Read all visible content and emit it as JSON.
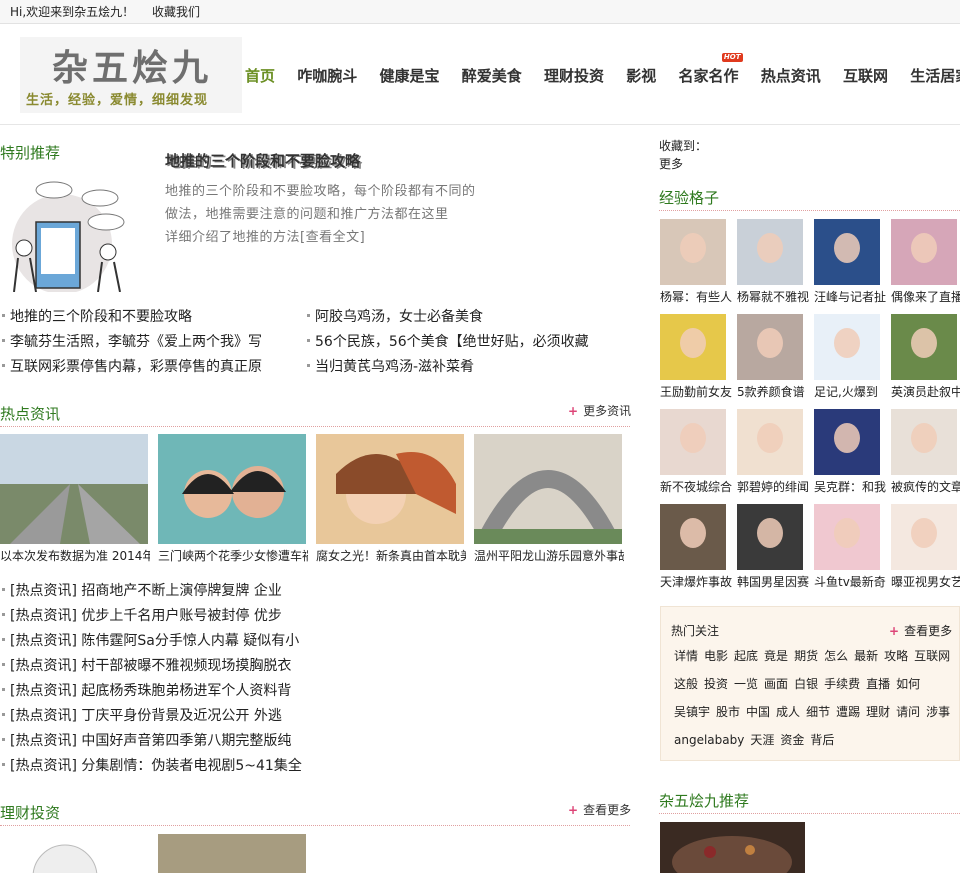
{
  "topbar": {
    "welcome": "Hi,欢迎来到杂五烩九！",
    "bookmark": "收藏我们"
  },
  "logo": {
    "title": "杂五烩九",
    "slogan": "生活，经验，爱情，细细发现"
  },
  "nav": {
    "items": [
      "首页",
      "咋咖腕斗",
      "健康是宝",
      "醉爱美食",
      "理财投资",
      "影视",
      "名家名作",
      "热点资讯",
      "互联网",
      "生活居家"
    ],
    "hot_badge": "HOT"
  },
  "featured": {
    "title": "特别推荐",
    "headline": "地推的三个阶段和不要脸攻略",
    "excerpt_lines": [
      "地推的三个阶段和不要脸攻略，每个阶段都有不同的",
      "做法，地推需要注意的问题和推广方法都在这里",
      "详细介绍了地推的方法[查看全文]"
    ],
    "links": [
      "地推的三个阶段和不要脸攻略",
      "阿胶乌鸡汤，女士必备美食",
      "李毓芬生活照，李毓芬《爱上两个我》写",
      "56个民族，56个美食【绝世好贴，必须收藏",
      "互联网彩票停售内幕，彩票停售的真正原",
      "当归黄芪乌鸡汤-滋补菜肴"
    ]
  },
  "hot_news": {
    "title": "热点资讯",
    "more": "更多资讯",
    "thumbs": [
      "以本次发布数据为准 2014年",
      "三门峡两个花季少女惨遭车祸",
      "腐女之光！新条真由首本耽美",
      "温州平阳龙山游乐园意外事故"
    ],
    "headlines": [
      "[热点资讯] 招商地产不断上演停牌复牌 企业",
      "[热点资讯] 优步上千名用户账号被封停 优步",
      "[热点资讯] 陈伟霆阿Sa分手惊人内幕 疑似有小",
      "[热点资讯] 村干部被曝不雅视频现场摸胸脱衣",
      "[热点资讯] 起底杨秀珠胞弟杨进军个人资料背",
      "[热点资讯] 丁庆平身份背景及近况公开 外逃",
      "[热点资讯] 中国好声音第四季第八期完整版纯",
      "[热点资讯] 分集剧情：伪装者电视剧5~41集全"
    ]
  },
  "finance": {
    "title": "理财投资",
    "more": "查看更多"
  },
  "sidebar": {
    "collect_label": "收藏到：",
    "more_label": "更多",
    "jingyan_title": "经验格子",
    "grid_captions": [
      "杨幂：有些人",
      "杨幂就不雅视",
      "汪峰与记者扯",
      "偶像来了直播",
      "王励勤前女友",
      "5款养颜食谱",
      "足记,火爆到",
      "英演员赴叙中",
      "新不夜城综合",
      "郭碧婷的绯闻",
      "吴克群：和我",
      "被疯传的文章",
      "天津爆炸事故",
      "韩国男星因赛",
      "斗鱼tv最新奇",
      "曝亚视男女艺"
    ],
    "tags_title": "热门关注",
    "tags_more": "查看更多",
    "tag_rows": [
      [
        "详情",
        "电影",
        "起底",
        "竟是",
        "期货",
        "怎么",
        "最新",
        "攻略",
        "互联网"
      ],
      [
        "这般",
        "投资",
        "一览",
        "画面",
        "白银",
        "手续费",
        "直播",
        "如何"
      ],
      [
        "吴镇宇",
        "股市",
        "中国",
        "成人",
        "细节",
        "遭踢",
        "理财",
        "请问",
        "涉事"
      ],
      [
        "angelababy",
        "天涯",
        "资金",
        "背后"
      ]
    ],
    "recommend_title": "杂五烩九推荐"
  },
  "colors": {
    "accent_green": "#2f7a1f",
    "nav_active": "#6b8f23",
    "hot_red": "#e03a1e"
  }
}
